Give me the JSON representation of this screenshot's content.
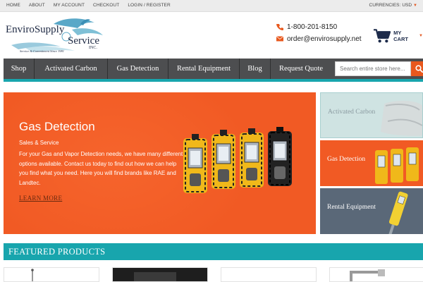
{
  "topbar": {
    "links": [
      "HOME",
      "ABOUT",
      "MY ACCOUNT",
      "CHECKOUT",
      "LOGIN / REGISTER"
    ],
    "currency_label": "CURRENCIES:",
    "currency_value": "USD"
  },
  "logo": {
    "line1": "EnviroSupply",
    "line2": "Service",
    "line3": "INC.",
    "tagline": "Service & Commitment Since 1981"
  },
  "contact": {
    "phone": "1-800-201-8150",
    "email": "order@envirosupply.net"
  },
  "cart": {
    "label": "MY CART"
  },
  "nav": {
    "items": [
      "Shop",
      "Activated Carbon",
      "Gas Detection",
      "Rental Equipment",
      "Blog",
      "Request Quote"
    ],
    "search_placeholder": "Search entire store here..."
  },
  "hero": {
    "title": "Gas Detection",
    "subtitle": "Sales & Service",
    "body": "For your Gas and Vapor Detection needs, we have many different options available. Contact us today to find out how we can help you find what you need. Here you will find brands like RAE and Landtec.",
    "link": "LEARN MORE"
  },
  "tiles": [
    "Activated Carbon",
    "Gas Detection",
    "Rental Equipment"
  ],
  "featured": {
    "title": "FEATURED PRODUCTS"
  },
  "colors": {
    "accent": "#18a5ad",
    "orange": "#f15a24",
    "nav": "#4d4e50",
    "navy": "#1d2b4a"
  }
}
